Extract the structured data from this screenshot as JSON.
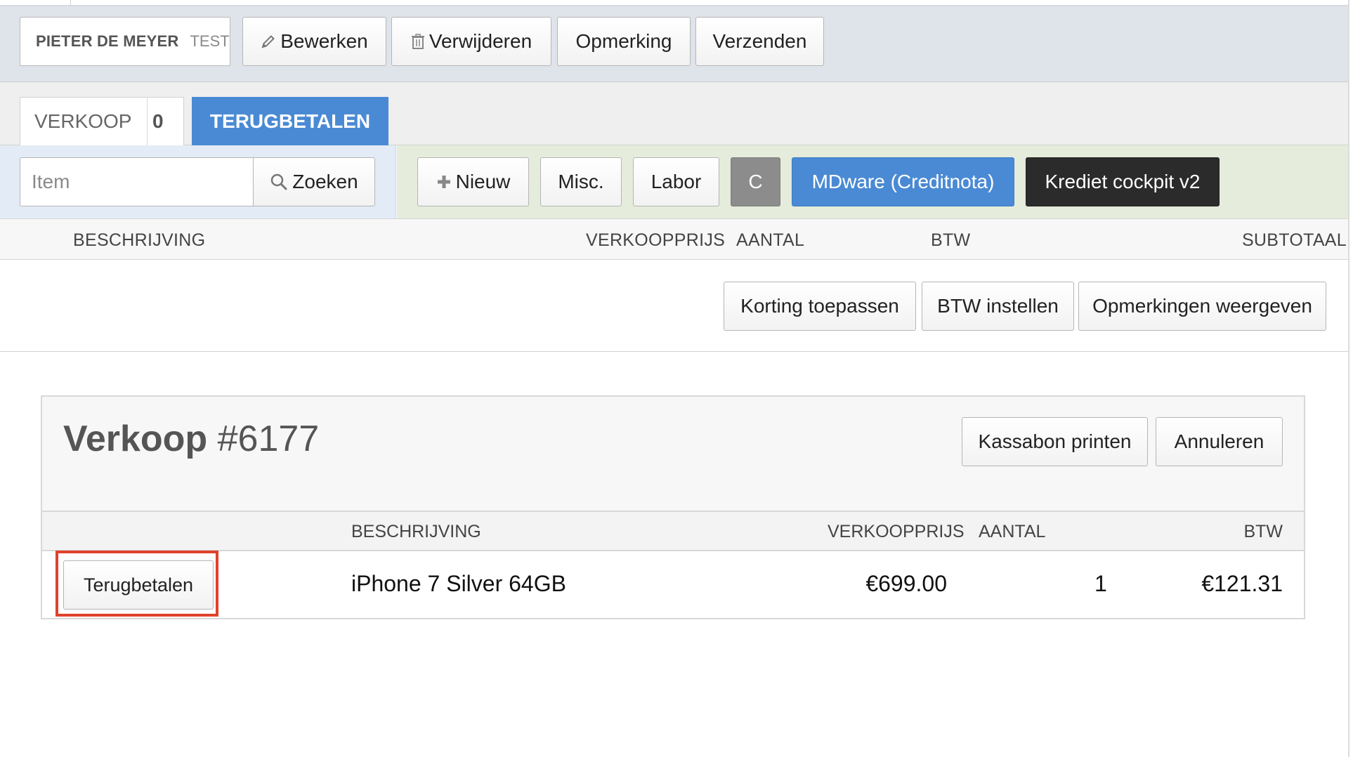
{
  "header": {
    "customer_name": "PIETER DE MEYER",
    "customer_tag": "TEST",
    "buttons": {
      "edit": "Bewerken",
      "delete": "Verwijderen",
      "remark": "Opmerking",
      "send": "Verzenden"
    }
  },
  "tabs": {
    "sale_label": "VERKOOP",
    "sale_count": "0",
    "refund_label": "TERUGBETALEN"
  },
  "search": {
    "placeholder": "Item",
    "button": "Zoeken"
  },
  "actions": {
    "new": "Nieuw",
    "misc": "Misc.",
    "labor": "Labor",
    "c": "C",
    "mdware": "MDware (Creditnota)",
    "credit_cockpit": "Krediet cockpit v2"
  },
  "columns": {
    "description": "BESCHRIJVING",
    "price": "VERKOOPPRIJS",
    "quantity": "AANTAL",
    "vat": "BTW",
    "subtotal": "SUBTOTAAL"
  },
  "options": {
    "discount": "Korting toepassen",
    "set_vat": "BTW instellen",
    "show_remarks": "Opmerkingen weergeven"
  },
  "sale": {
    "title_prefix": "Verkoop",
    "title_number": "#6177",
    "print_receipt": "Kassabon printen",
    "cancel": "Annuleren",
    "columns": {
      "description": "BESCHRIJVING",
      "price": "VERKOOPPRIJS",
      "quantity": "AANTAL",
      "vat": "BTW"
    },
    "rows": [
      {
        "action": "Terugbetalen",
        "description": "iPhone 7 Silver 64GB",
        "price": "€699.00",
        "quantity": "1",
        "vat": "€121.31"
      }
    ]
  },
  "colors": {
    "tab_active": "#4a8ad4",
    "mdware_button": "#4a8ad4",
    "cockpit_button": "#2b2b2b",
    "c_button": "#8c8c8c",
    "highlight": "#e0432b",
    "header_bg": "#dfe4eb"
  },
  "icons": {
    "edit": "pencil-icon",
    "delete": "trash-icon",
    "search": "search-icon",
    "new": "plus-icon"
  }
}
